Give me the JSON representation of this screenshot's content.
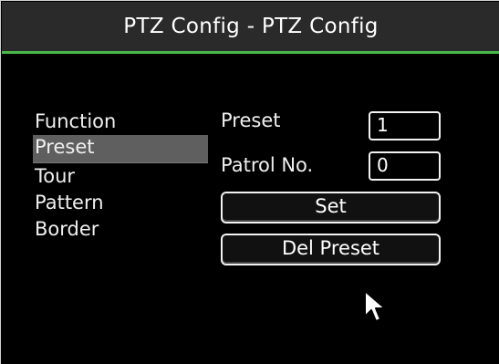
{
  "window": {
    "title": "PTZ Config - PTZ Config"
  },
  "menu": {
    "items": [
      {
        "label": "Function"
      },
      {
        "label": "Preset",
        "selected": true
      },
      {
        "label": "Tour"
      },
      {
        "label": "Pattern"
      },
      {
        "label": "Border"
      }
    ]
  },
  "form": {
    "preset_label": "Preset",
    "preset_value": "1",
    "patrol_label": "Patrol No.",
    "patrol_value": "0",
    "set_button": "Set",
    "del_preset_button": "Del Preset"
  },
  "theme": {
    "accent": "#49b84a",
    "title_bg": "#2a2a2a",
    "selected_bg": "#5f5f5f"
  },
  "icons": {
    "pointer": "mouse-pointer-icon"
  }
}
